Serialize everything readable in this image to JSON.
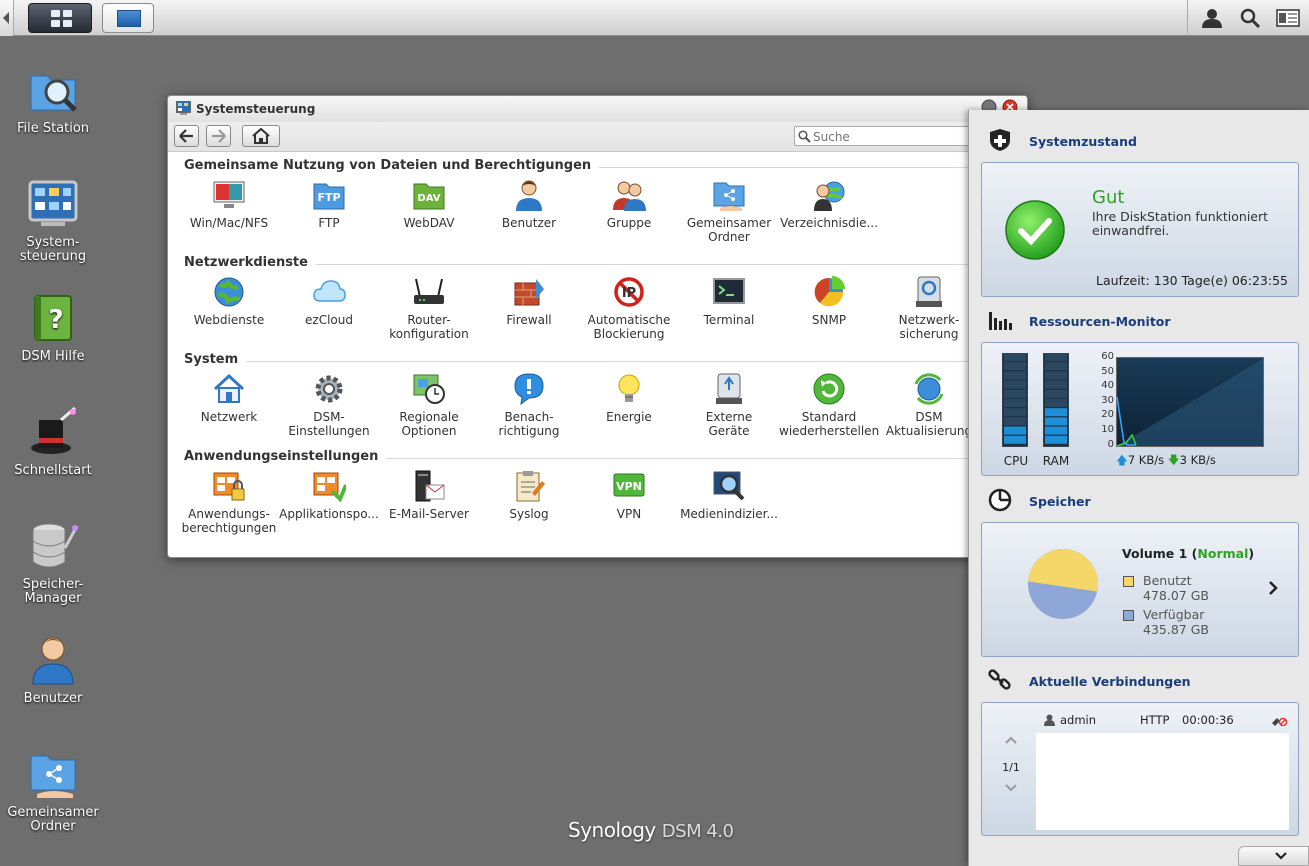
{
  "desktop": {
    "icons": [
      {
        "label": "File Station"
      },
      {
        "label": "System-\nsteuerung"
      },
      {
        "label": "DSM Hilfe"
      },
      {
        "label": "Schnellstart"
      },
      {
        "label": "Speicher-\nManager"
      },
      {
        "label": "Benutzer"
      },
      {
        "label": "Gemeinsamer\nOrdner"
      }
    ],
    "brand": "Synology",
    "brand_version": "DSM 4.0"
  },
  "window": {
    "title": "Systemsteuerung",
    "search_placeholder": "Suche",
    "sections": [
      {
        "title": "Gemeinsame Nutzung von Dateien und Berechtigungen",
        "items": [
          "Win/Mac/NFS",
          "FTP",
          "WebDAV",
          "Benutzer",
          "Gruppe",
          "Gemeinsamer\nOrdner",
          "Verzeichnisdie..."
        ]
      },
      {
        "title": "Netzwerkdienste",
        "items": [
          "Webdienste",
          "ezCloud",
          "Router-\nkonfiguration",
          "Firewall",
          "Automatische\nBlockierung",
          "Terminal",
          "SNMP",
          "Netzwerk-\nsicherung"
        ]
      },
      {
        "title": "System",
        "items": [
          "Netzwerk",
          "DSM-\nEinstellungen",
          "Regionale\nOptionen",
          "Benach-\nrichtigung",
          "Energie",
          "Externe\nGeräte",
          "Standard\nwiederherstellen",
          "DSM\nAktualisierung"
        ]
      },
      {
        "title": "Anwendungseinstellungen",
        "items": [
          "Anwendungs-\nberechtigungen",
          "Applikationspo...",
          "E-Mail-Server",
          "Syslog",
          "VPN",
          "Medienindizier..."
        ]
      }
    ]
  },
  "widgets": {
    "health": {
      "title": "Systemzustand",
      "status": "Gut",
      "message": "Ihre DiskStation funktioniert einwandfrei.",
      "uptime": "Laufzeit: 130 Tage(e) 06:23:55"
    },
    "resources": {
      "title": "Ressourcen-Monitor",
      "cpu_label": "CPU",
      "ram_label": "RAM",
      "cpu_percent": 18,
      "ram_percent": 40,
      "y_ticks": [
        "60",
        "50",
        "40",
        "30",
        "20",
        "10",
        "0"
      ],
      "upload": "7 KB/s",
      "download": "3 KB/s",
      "accent": "#1e8fd6"
    },
    "storage": {
      "title": "Speicher",
      "volume": "Volume 1",
      "volume_status": "Normal",
      "used_label": "Benutzt",
      "used_value": "478.07 GB",
      "free_label": "Verfügbar",
      "free_value": "435.87 GB",
      "used_color": "#f5d769",
      "free_color": "#8ea6d8",
      "used_fraction": 0.523
    },
    "connections": {
      "title": "Aktuelle Verbindungen",
      "page": "1/1",
      "rows": [
        {
          "user": "admin",
          "protocol": "HTTP",
          "time": "00:00:36"
        }
      ]
    }
  }
}
